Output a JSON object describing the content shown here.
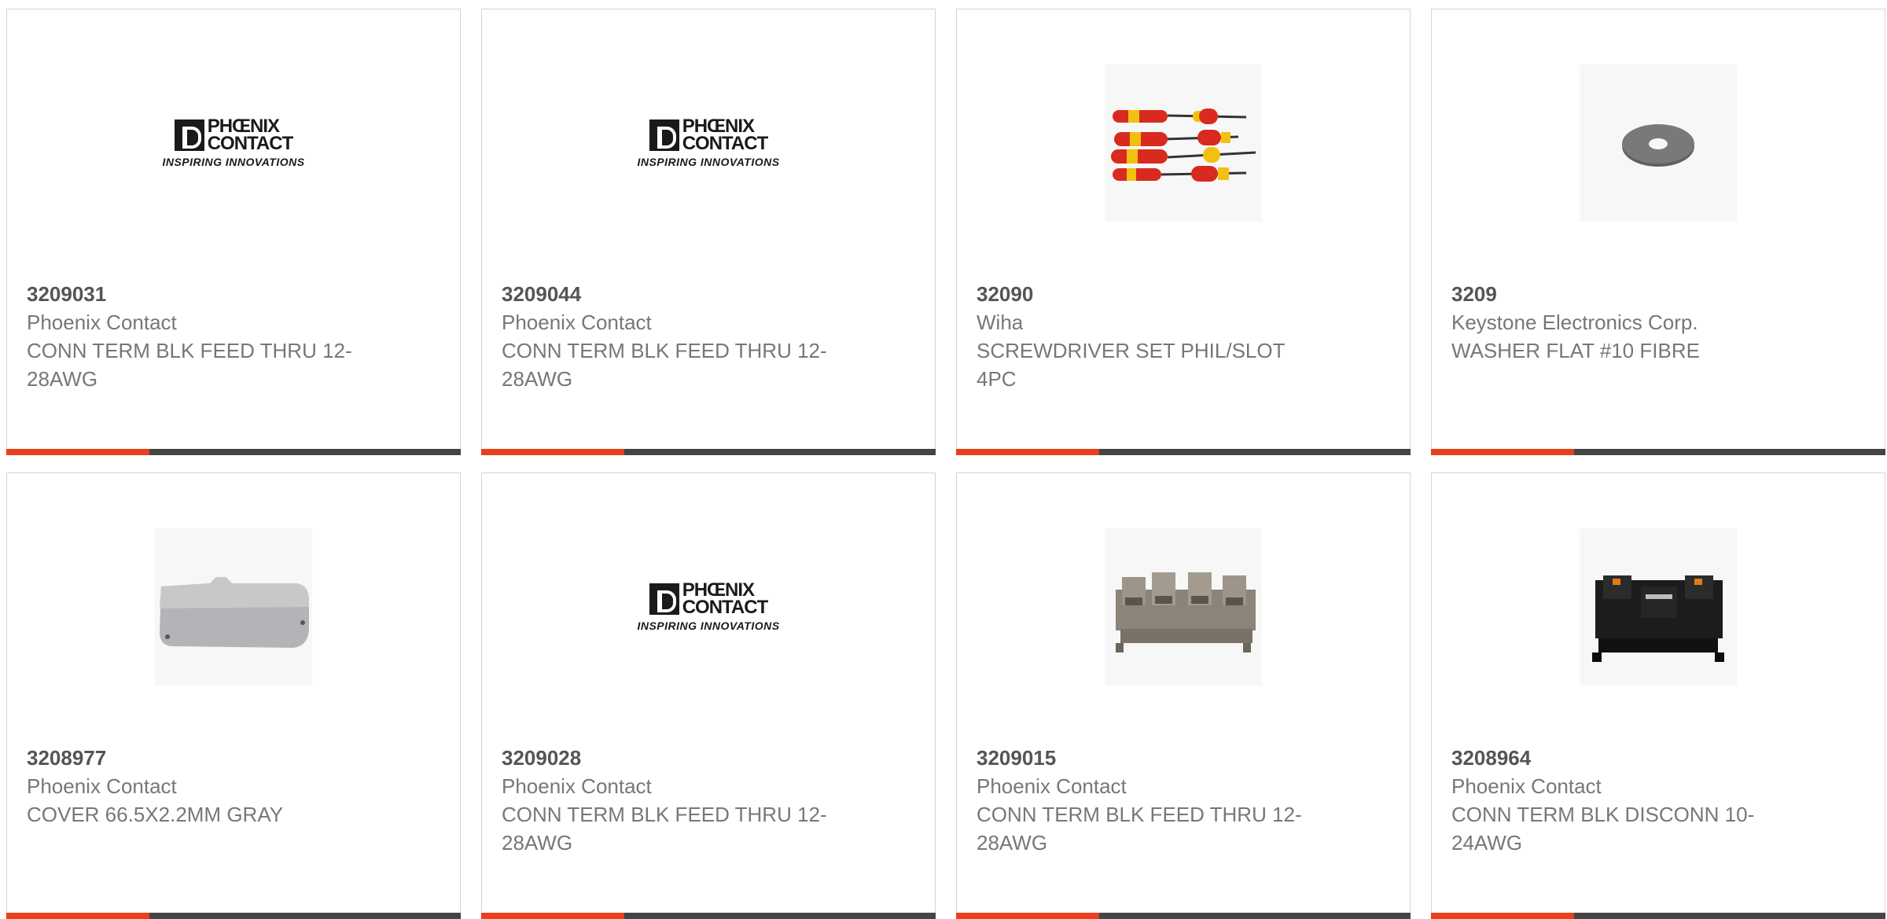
{
  "products": [
    {
      "part": "3209031",
      "manufacturer": "Phoenix Contact",
      "description": "CONN TERM BLK FEED THRU 12-28AWG",
      "image": "phoenix-contact-logo"
    },
    {
      "part": "3209044",
      "manufacturer": "Phoenix Contact",
      "description": "CONN TERM BLK FEED THRU 12-28AWG",
      "image": "phoenix-contact-logo"
    },
    {
      "part": "32090",
      "manufacturer": "Wiha",
      "description": "SCREWDRIVER SET PHIL/SLOT 4PC",
      "image": "screwdriver-set-photo"
    },
    {
      "part": "3209",
      "manufacturer": "Keystone Electronics Corp.",
      "description": "WASHER FLAT #10 FIBRE",
      "image": "washer-photo"
    },
    {
      "part": "3208977",
      "manufacturer": "Phoenix Contact",
      "description": "COVER 66.5X2.2MM GRAY",
      "image": "cover-photo"
    },
    {
      "part": "3209028",
      "manufacturer": "Phoenix Contact",
      "description": "CONN TERM BLK FEED THRU 12-28AWG",
      "image": "phoenix-contact-logo"
    },
    {
      "part": "3209015",
      "manufacturer": "Phoenix Contact",
      "description": "CONN TERM BLK FEED THRU 12-28AWG",
      "image": "terminal-block-photo"
    },
    {
      "part": "3208964",
      "manufacturer": "Phoenix Contact",
      "description": "CONN TERM BLK DISCONN 10-24AWG",
      "image": "disconnect-terminal-photo"
    }
  ],
  "logo": {
    "line1": "PHŒNIX",
    "line2": "CONTACT",
    "tagline": "INSPIRING INNOVATIONS"
  },
  "colors": {
    "accent": "#e8401c",
    "bar": "#444444",
    "part_text": "#555555",
    "meta_text": "#777777"
  }
}
